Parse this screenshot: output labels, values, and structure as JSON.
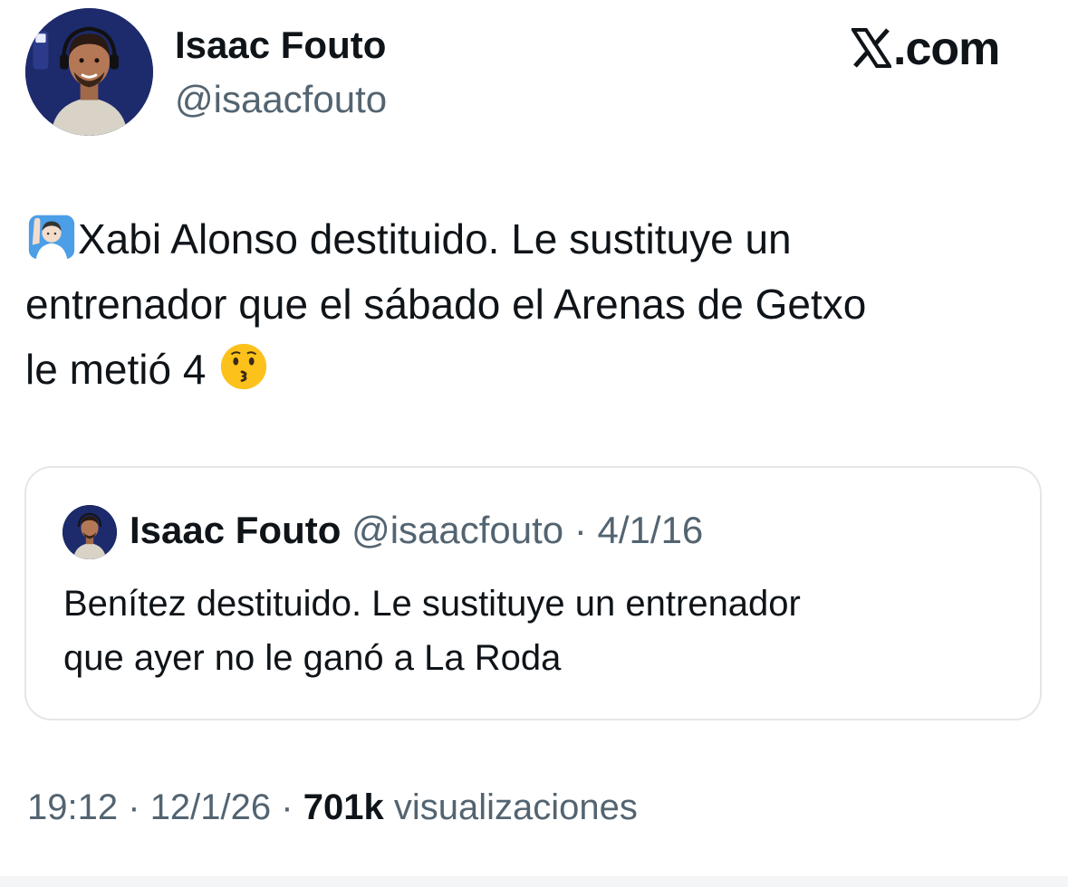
{
  "brand": {
    "label": ".com",
    "icon": "x-logo-icon"
  },
  "tweet": {
    "author_name": "Isaac Fouto",
    "author_handle": "@isaacfouto",
    "avatar_icon": "avatar-icon",
    "text_lines": [
      "Xabi Alonso destituido. Le sustituye un",
      "entrenador que el sábado el Arenas de Getxo",
      "le metió 4"
    ],
    "leading_emoji": "person-raising-hand-icon",
    "trailing_emoji": "kissing-face-icon",
    "time": "19:12",
    "date": "12/1/26",
    "views_count": "701k",
    "views_label": "visualizaciones",
    "separator": "·"
  },
  "quote": {
    "author_name": "Isaac Fouto",
    "author_handle": "@isaacfouto",
    "date": "4/1/16",
    "separator": "·",
    "text_lines": [
      "Benítez destituido. Le sustituye un entrenador",
      "que ayer no le ganó a La Roda"
    ]
  },
  "colors": {
    "text_primary": "#0f1419",
    "text_secondary": "#536471",
    "card_border": "#e4e7ea",
    "avatar_bg": "#1d2a6b"
  }
}
